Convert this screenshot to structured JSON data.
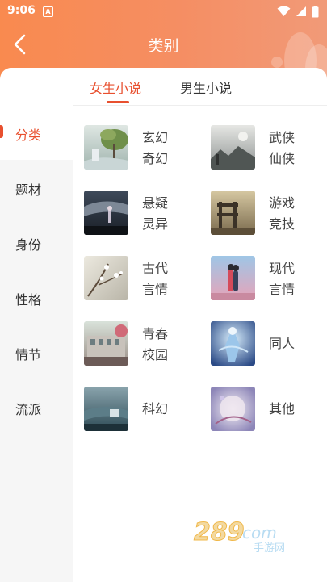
{
  "status_bar": {
    "time": "9:06",
    "notif_letter": "A"
  },
  "nav": {
    "title": "类别",
    "back_icon": "back-arrow-icon"
  },
  "tabs": [
    {
      "label": "女生小说",
      "active": true
    },
    {
      "label": "男生小说",
      "active": false
    }
  ],
  "sidebar": {
    "items": [
      {
        "label": "分类",
        "active": true
      },
      {
        "label": "题材",
        "active": false
      },
      {
        "label": "身份",
        "active": false
      },
      {
        "label": "性格",
        "active": false
      },
      {
        "label": "情节",
        "active": false
      },
      {
        "label": "流派",
        "active": false
      }
    ]
  },
  "genres": [
    {
      "name": "玄幻奇幻"
    },
    {
      "name": "武侠仙侠"
    },
    {
      "name": "悬疑灵异"
    },
    {
      "name": "游戏竞技"
    },
    {
      "name": "古代言情"
    },
    {
      "name": "现代言情"
    },
    {
      "name": "青春校园"
    },
    {
      "name": "同人"
    },
    {
      "name": "科幻"
    },
    {
      "name": "其他"
    }
  ],
  "watermark": {
    "brand": "289",
    "suffix": "com",
    "sub": "手游网"
  },
  "colors": {
    "header_orange": "#f98a4f",
    "accent_red": "#e8502f",
    "sidebar_bg": "#f6f6f6"
  }
}
